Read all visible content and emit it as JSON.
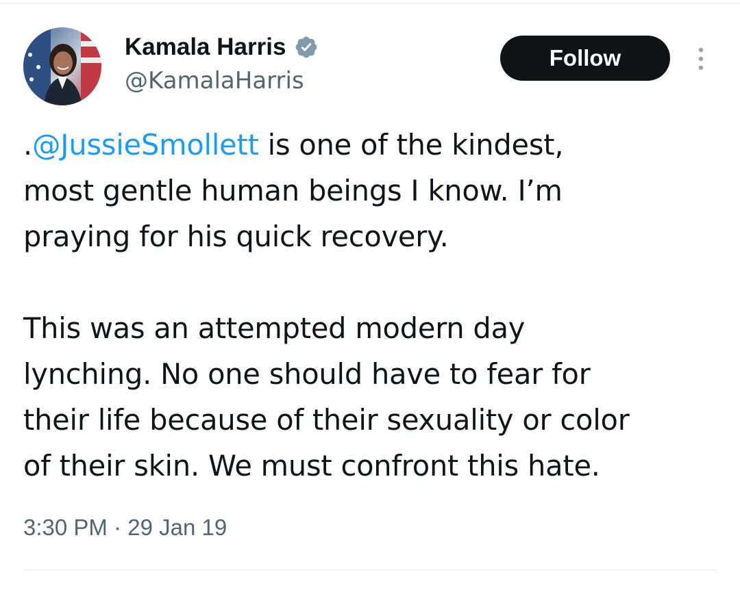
{
  "author": {
    "display_name": "Kamala Harris",
    "handle": "@KamalaHarris",
    "verified_icon": "verified-badge-icon",
    "badge_color": "#829aab"
  },
  "actions": {
    "follow_label": "Follow",
    "more_icon": "more-vertical-icon"
  },
  "tweet": {
    "mention": "@JussieSmollett",
    "prefix": ".",
    "text_after_mention": " is one of the kindest,\nmost gentle human beings I know. I’m\npraying for his quick recovery.\n\nThis was an attempted modern day\nlynching. No one should have to fear for\ntheir life because of their sexuality or color\nof their skin. We must confront this hate."
  },
  "meta": {
    "time": "3:30 PM",
    "separator": "·",
    "date": "29 Jan 19"
  },
  "colors": {
    "text": "#0f1419",
    "secondary": "#536471",
    "link": "#1d9bf0",
    "button_bg": "#0f1419",
    "divider": "#eff3f4"
  }
}
